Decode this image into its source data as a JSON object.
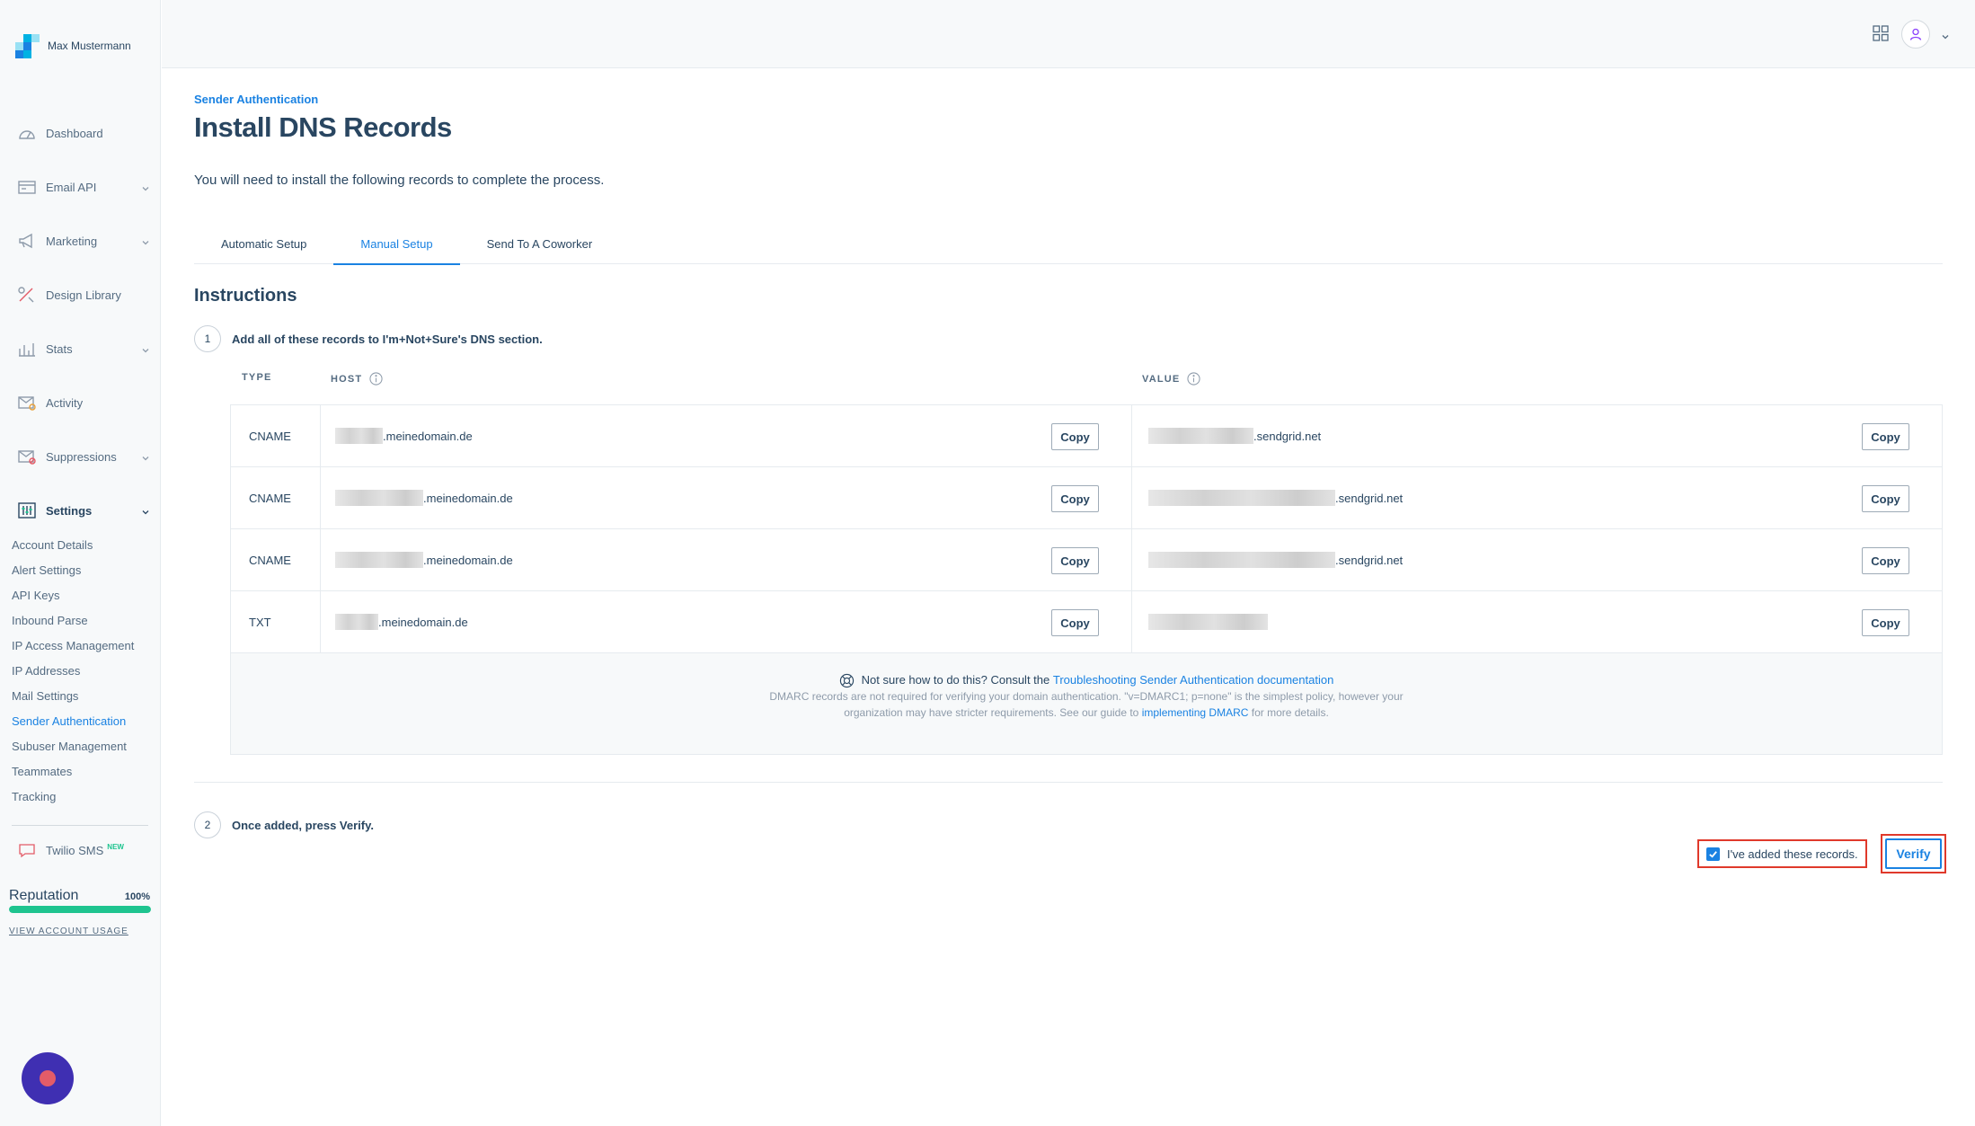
{
  "app": {
    "user_name": "Max Mustermann",
    "brand_colors": [
      "#1a82e2",
      "#00b2e3",
      "#99e1f4"
    ]
  },
  "sidebar": {
    "items": [
      {
        "label": "Dashboard",
        "icon": "dashboard-icon",
        "has_chevron": false
      },
      {
        "label": "Email API",
        "icon": "email-api-icon",
        "has_chevron": true
      },
      {
        "label": "Marketing",
        "icon": "megaphone-icon",
        "has_chevron": true
      },
      {
        "label": "Design Library",
        "icon": "design-library-icon",
        "has_chevron": false
      },
      {
        "label": "Stats",
        "icon": "stats-icon",
        "has_chevron": true
      },
      {
        "label": "Activity",
        "icon": "activity-icon",
        "has_chevron": false
      },
      {
        "label": "Suppressions",
        "icon": "suppressions-icon",
        "has_chevron": true
      },
      {
        "label": "Settings",
        "icon": "settings-icon",
        "has_chevron": true
      }
    ],
    "settings_sub": [
      "Account Details",
      "Alert Settings",
      "API Keys",
      "Inbound Parse",
      "IP Access Management",
      "IP Addresses",
      "Mail Settings",
      "Sender Authentication",
      "Subuser Management",
      "Teammates",
      "Tracking"
    ],
    "current_sub": "Sender Authentication",
    "twilio_label": "Twilio SMS",
    "twilio_badge": "NEW",
    "reputation_label": "Reputation",
    "reputation_value": "100%",
    "reputation_fraction": 1.0,
    "view_usage": "VIEW ACCOUNT USAGE"
  },
  "main": {
    "breadcrumb": "Sender Authentication",
    "title": "Install DNS Records",
    "intro": "You will need to install the following records to complete the process.",
    "tabs": [
      {
        "label": "Automatic Setup",
        "active": false
      },
      {
        "label": "Manual Setup",
        "active": true
      },
      {
        "label": "Send To A Coworker",
        "active": false
      }
    ],
    "instructions_title": "Instructions",
    "step1_num": "1",
    "step1_text": "Add all of these records to I'm+Not+Sure's DNS section.",
    "col_type": "TYPE",
    "col_host": "HOST",
    "col_value": "VALUE",
    "copy_label": "Copy",
    "records": [
      {
        "type": "CNAME",
        "host_suffix": ".meinedomain.de",
        "value_suffix": ".sendgrid.net"
      },
      {
        "type": "CNAME",
        "host_suffix": ".meinedomain.de",
        "value_suffix": ".sendgrid.net"
      },
      {
        "type": "CNAME",
        "host_suffix": ".meinedomain.de",
        "value_suffix": ".sendgrid.net"
      },
      {
        "type": "TXT",
        "host_suffix": ".meinedomain.de",
        "value_suffix": ""
      }
    ],
    "help": {
      "lead": "Not sure how to do this? Consult the",
      "doc_link": "Troubleshooting Sender Authentication documentation",
      "body_1": "DMARC records are not required for verifying your domain authentication. \"v=DMARC1; p=none\" is the simplest policy, however your organization may have stricter requirements. See our guide to",
      "dmarc_link": "implementing DMARC",
      "body_2": "for more details."
    },
    "step2_num": "2",
    "step2_text": "Once added, press Verify.",
    "ack_label": "I've added these records.",
    "ack_checked": true,
    "verify_label": "Verify"
  }
}
